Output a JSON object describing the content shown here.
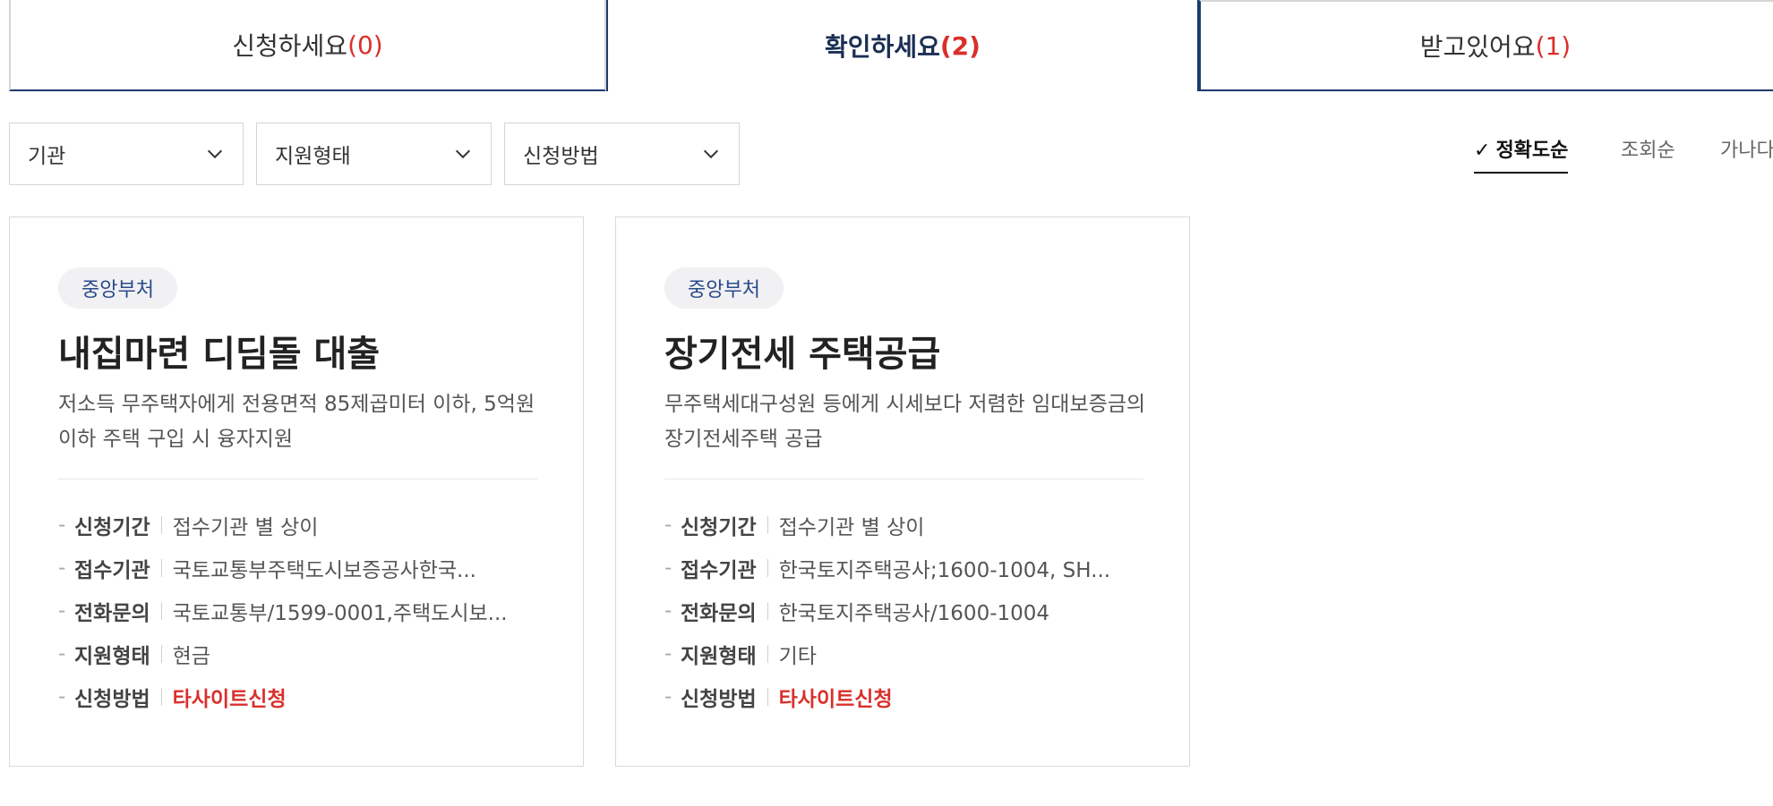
{
  "tabs": [
    {
      "label": "신청하세요",
      "count": "(0)"
    },
    {
      "label": "확인하세요",
      "count": "(2)"
    },
    {
      "label": "받고있어요",
      "count": "(1)"
    }
  ],
  "filters": [
    {
      "label": "기관"
    },
    {
      "label": "지원형태"
    },
    {
      "label": "신청방법"
    }
  ],
  "sort": {
    "active_check": "✓",
    "active": "정확도순",
    "option_2": "조회순",
    "option_3": "가나다"
  },
  "cards": [
    {
      "badge": "중앙부처",
      "title": "내집마련 디딤돌 대출",
      "desc": "저소득 무주택자에게 전용면적 85제곱미터 이하, 5억원 이하 주택 구입 시 융자지원",
      "rows": [
        {
          "label": "신청기간",
          "value": "접수기관 별 상이"
        },
        {
          "label": "접수기관",
          "value": "국토교통부주택도시보증공사한국..."
        },
        {
          "label": "전화문의",
          "value": "국토교통부/1599-0001,주택도시보..."
        },
        {
          "label": "지원형태",
          "value": "현금"
        },
        {
          "label": "신청방법",
          "value": "타사이트신청"
        }
      ]
    },
    {
      "badge": "중앙부처",
      "title": "장기전세 주택공급",
      "desc": "무주택세대구성원 등에게 시세보다 저렴한 임대보증금의 장기전세주택 공급",
      "rows": [
        {
          "label": "신청기간",
          "value": "접수기관 별 상이"
        },
        {
          "label": "접수기관",
          "value": "한국토지주택공사;1600-1004, SH..."
        },
        {
          "label": "전화문의",
          "value": "한국토지주택공사/1600-1004"
        },
        {
          "label": "지원형태",
          "value": "기타"
        },
        {
          "label": "신청방법",
          "value": "타사이트신청"
        }
      ]
    }
  ],
  "colors": {
    "accent_red": "#d9302c",
    "navy": "#1d3a6b",
    "badge_text": "#2a4a8c"
  }
}
